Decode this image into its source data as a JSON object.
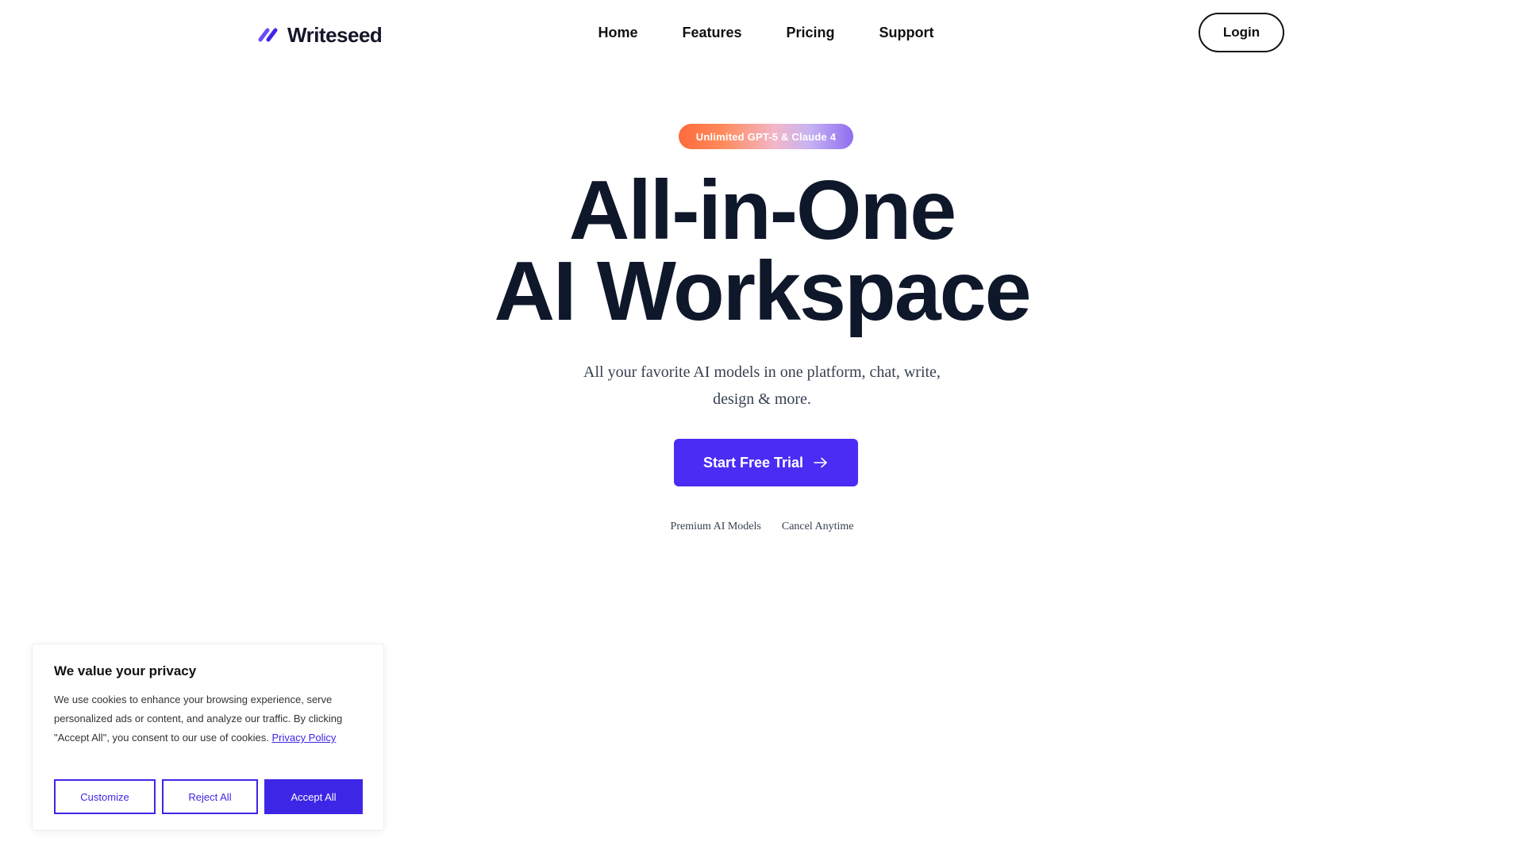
{
  "header": {
    "logo_text": "Writeseed",
    "nav": {
      "home": "Home",
      "features": "Features",
      "pricing": "Pricing",
      "support": "Support"
    },
    "login_label": "Login"
  },
  "hero": {
    "badge": "Unlimited GPT-5 & Claude 4",
    "title_line1": "All-in-One",
    "title_line2": "AI Workspace",
    "subtitle_line1": "All your favorite AI models in one platform, chat, write,",
    "subtitle_line2": "design & more.",
    "cta_label": "Start Free Trial",
    "features": [
      "Premium AI Models",
      "Cancel Anytime"
    ]
  },
  "cookie_banner": {
    "title": "We value your privacy",
    "text": "We use cookies to enhance your browsing experience, serve personalized ads or content, and analyze our traffic. By clicking \"Accept All\", you consent to our use of cookies.",
    "privacy_link": "Privacy Policy",
    "customize_label": "Customize",
    "reject_label": "Reject All",
    "accept_label": "Accept All"
  },
  "colors": {
    "brand": "#4a2cf5",
    "text_dark": "#0f172a",
    "cookie_accent": "#3d26e6"
  },
  "icons": {
    "logo": "writeseed-slash-logo-icon",
    "cta_arrow": "arrow-right-icon"
  }
}
